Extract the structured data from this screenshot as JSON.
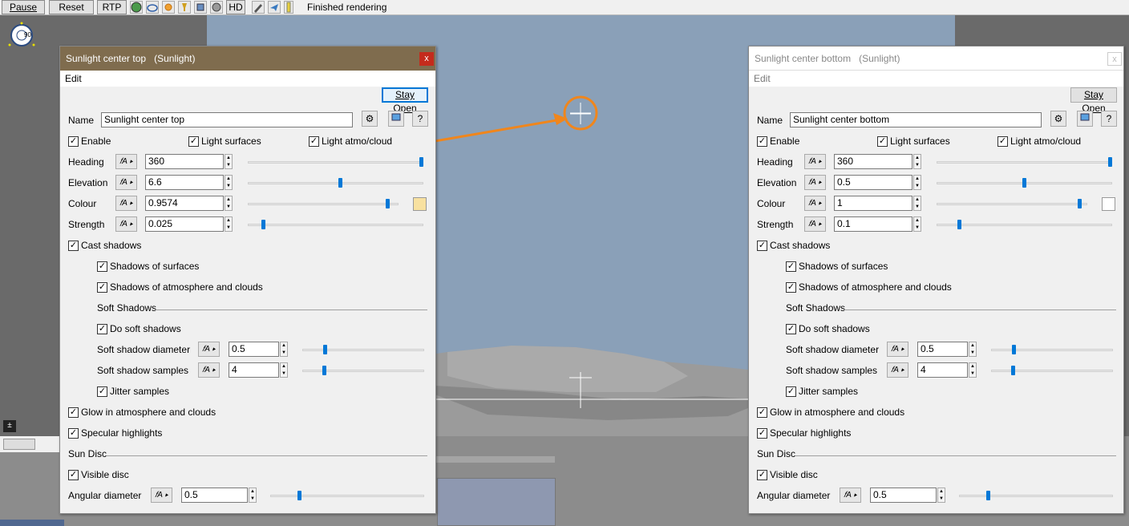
{
  "toolbar": {
    "pause": "Pause",
    "reset": "Reset",
    "rtp": "RTP",
    "hd": "HD",
    "status": "Finished rendering",
    "icons": [
      "sphere-icon",
      "cloud-icon",
      "sun-icon",
      "lamp-icon",
      "cube-icon",
      "film-icon"
    ]
  },
  "compass": {
    "label": "90"
  },
  "panels": [
    {
      "title": "Sunlight center top",
      "title_type": "(Sunlight)",
      "menu_edit": "Edit",
      "stay_open": "Stay Open",
      "close": "x",
      "name_label": "Name",
      "name_value": "Sunlight center top",
      "enable": "Enable",
      "light_surfaces": "Light surfaces",
      "light_atmo": "Light atmo/cloud",
      "heading_label": "Heading",
      "heading_value": "360",
      "heading_fraction": 1.0,
      "elevation_label": "Elevation",
      "elevation_value": "6.6",
      "elevation_fraction": 0.53,
      "colour_label": "Colour",
      "colour_value": "0.9574",
      "colour_fraction": 0.94,
      "colour_swatch": "#f8e1a0",
      "strength_label": "Strength",
      "strength_value": "0.025",
      "strength_fraction": 0.08,
      "cast_shadows": "Cast shadows",
      "shadows_surfaces": "Shadows of surfaces",
      "shadows_atmo": "Shadows of atmosphere and clouds",
      "soft_shadows": "Soft Shadows",
      "do_soft": "Do soft shadows",
      "soft_diam_label": "Soft shadow diameter",
      "soft_diam_value": "0.5",
      "soft_diam_fraction": 0.18,
      "soft_samples_label": "Soft shadow samples",
      "soft_samples_value": "4",
      "soft_samples_fraction": 0.17,
      "jitter": "Jitter samples",
      "glow": "Glow in atmosphere and clouds",
      "specular": "Specular highlights",
      "sun_disc": "Sun Disc",
      "visible_disc": "Visible disc",
      "angular_label": "Angular diameter",
      "angular_value": "0.5",
      "angular_fraction": 0.18
    },
    {
      "title": "Sunlight center bottom",
      "title_type": "(Sunlight)",
      "menu_edit": "Edit",
      "stay_open": "Stay Open",
      "close": "x",
      "name_label": "Name",
      "name_value": "Sunlight center bottom",
      "enable": "Enable",
      "light_surfaces": "Light surfaces",
      "light_atmo": "Light atmo/cloud",
      "heading_label": "Heading",
      "heading_value": "360",
      "heading_fraction": 1.0,
      "elevation_label": "Elevation",
      "elevation_value": "0.5",
      "elevation_fraction": 0.5,
      "colour_label": "Colour",
      "colour_value": "1",
      "colour_fraction": 0.96,
      "colour_swatch": "#ffffff",
      "strength_label": "Strength",
      "strength_value": "0.1",
      "strength_fraction": 0.12,
      "cast_shadows": "Cast shadows",
      "shadows_surfaces": "Shadows of surfaces",
      "shadows_atmo": "Shadows of atmosphere and clouds",
      "soft_shadows": "Soft Shadows",
      "do_soft": "Do soft shadows",
      "soft_diam_label": "Soft shadow diameter",
      "soft_diam_value": "0.5",
      "soft_diam_fraction": 0.18,
      "soft_samples_label": "Soft shadow samples",
      "soft_samples_value": "4",
      "soft_samples_fraction": 0.17,
      "jitter": "Jitter samples",
      "glow": "Glow in atmosphere and clouds",
      "specular": "Specular highlights",
      "sun_disc": "Sun Disc",
      "visible_disc": "Visible disc",
      "angular_label": "Angular diameter",
      "angular_value": "0.5",
      "angular_fraction": 0.18
    }
  ],
  "colors": {
    "accent": "#0078d7",
    "annotation": "#f0861c",
    "sky": "#8aa0b8"
  }
}
